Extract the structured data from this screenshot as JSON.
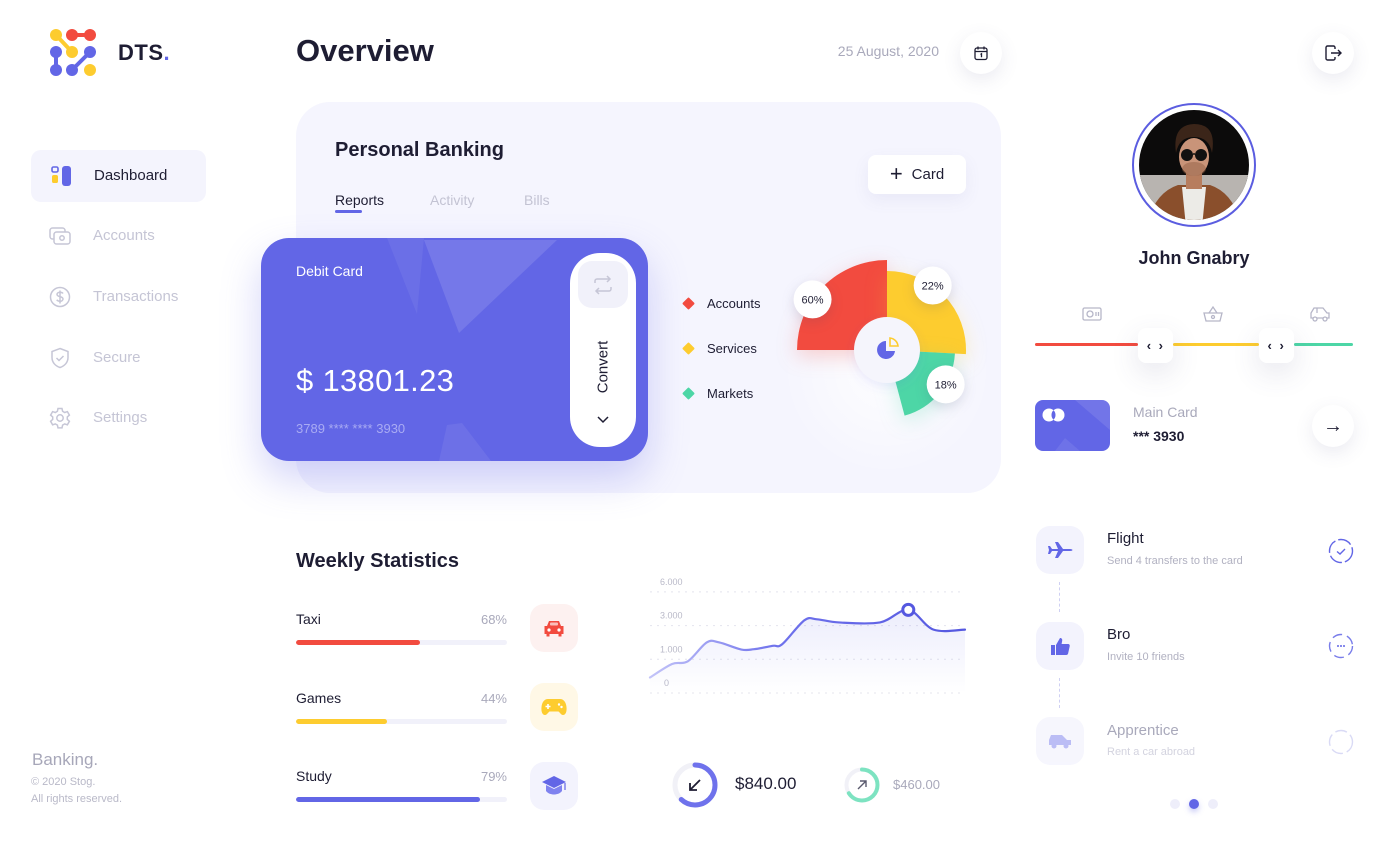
{
  "brand": {
    "name": "DTS",
    "dot": "."
  },
  "sidebar": {
    "items": [
      {
        "label": "Dashboard",
        "icon": "dashboard-icon",
        "active": true
      },
      {
        "label": "Accounts",
        "icon": "accounts-icon",
        "active": false
      },
      {
        "label": "Transactions",
        "icon": "dollar-circle-icon",
        "active": false
      },
      {
        "label": "Secure",
        "icon": "shield-check-icon",
        "active": false
      },
      {
        "label": "Settings",
        "icon": "gear-icon",
        "active": false
      }
    ],
    "footer": {
      "title": "Banking.",
      "copyright": "© 2020 Stog.",
      "rights": "All rights reserved."
    }
  },
  "header": {
    "title": "Overview",
    "date": "25 August, 2020",
    "calendar_icon": "calendar-icon",
    "logout_icon": "logout-icon"
  },
  "personal_banking": {
    "title": "Personal Banking",
    "tabs": [
      {
        "label": "Reports",
        "active": true
      },
      {
        "label": "Activity",
        "active": false
      },
      {
        "label": "Bills",
        "active": false
      }
    ],
    "add_card": {
      "icon": "+",
      "label": "Card"
    }
  },
  "debit_card": {
    "label": "Debit Card",
    "balance": "$ 13801.23",
    "number": "3789 **** **** 3930",
    "convert_label": "Convert"
  },
  "distribution": {
    "legend": [
      {
        "label": "Accounts",
        "color": "#f24b3f"
      },
      {
        "label": "Services",
        "color": "#fdcc2f"
      },
      {
        "label": "Markets",
        "color": "#4dd6a6"
      }
    ]
  },
  "weekly": {
    "title": "Weekly Statistics",
    "rows": [
      {
        "label": "Taxi",
        "value_label": "68%",
        "bar_fill": 0.59,
        "color": "#f24b3f",
        "icon_bg": "#fdf1f0",
        "icon": "car-icon"
      },
      {
        "label": "Games",
        "value_label": "44%",
        "bar_fill": 0.43,
        "color": "#fdcc2f",
        "icon_bg": "#fff8e6",
        "icon": "gamepad-icon"
      },
      {
        "label": "Study",
        "value_label": "79%",
        "bar_fill": 0.87,
        "color": "#6266e6",
        "icon_bg": "#f3f3fd",
        "icon": "graduation-cap-icon"
      }
    ]
  },
  "summary": [
    {
      "amount": "$840.00",
      "icon": "arrow-down-left-icon",
      "progress": 0.62,
      "color": "#6f72ec"
    },
    {
      "amount": "$460.00",
      "icon": "arrow-up-right-icon",
      "progress": 0.66,
      "color": "#7de3c1"
    }
  ],
  "profile": {
    "name": "John Gnabry",
    "ring_color": "#5b5de0"
  },
  "spend_slider": {
    "icons": [
      "cash-icon",
      "basket-icon",
      "car-icon"
    ],
    "handles": [
      0.38,
      0.76
    ],
    "segment_colors": [
      "#f24b3f",
      "#fdcc2f",
      "#4dd6a6"
    ],
    "handle_glyph": "‹ ›"
  },
  "main_card": {
    "label": "Main Card",
    "number": "*** 3930",
    "arrow": "→"
  },
  "tasks": [
    {
      "title": "Flight",
      "subtitle": "Send 4 transfers to the card",
      "icon": "plane-icon",
      "status": "done"
    },
    {
      "title": "Bro",
      "subtitle": "Invite 10 friends",
      "icon": "thumbs-up-icon",
      "status": "in-progress"
    },
    {
      "title": "Apprentice",
      "subtitle": "Rent a car abroad",
      "icon": "car-icon",
      "status": "locked"
    }
  ],
  "pagination": {
    "count": 3,
    "active": 1
  },
  "colors": {
    "accent": "#6266e6",
    "red": "#f24b3f",
    "yellow": "#fdcc2f",
    "green": "#4dd6a6",
    "text": "#1e1d33",
    "muted": "#a9a9bb"
  },
  "chart_data": [
    {
      "type": "pie",
      "title": "",
      "style": "polar-rose",
      "categories": [
        "Accounts",
        "Services",
        "Markets"
      ],
      "values": [
        60,
        22,
        18
      ],
      "labels": [
        "60%",
        "22%",
        "18%"
      ],
      "colors": [
        "#f24b3f",
        "#fdcc2f",
        "#4dd6a6"
      ],
      "legend": "left"
    },
    {
      "type": "line",
      "title": "",
      "xlabel": "",
      "ylabel": "",
      "y_ticks": [
        0,
        1000,
        3000,
        6000
      ],
      "y_tick_labels": [
        "0",
        "1.000",
        "3.000",
        "6.000"
      ],
      "y_scale": "piecewise-even-ticks",
      "grid": true,
      "x": [
        0,
        7,
        12,
        18,
        22,
        29,
        33,
        39,
        42,
        49,
        53,
        60,
        73,
        82,
        90,
        100
      ],
      "series": [
        {
          "name": "Weekly",
          "values": [
            460,
            860,
            940,
            2000,
            2000,
            1580,
            1600,
            1800,
            1900,
            3470,
            3560,
            3280,
            3280,
            4400,
            2760,
            2760
          ]
        }
      ],
      "highlight_index": 13
    }
  ]
}
